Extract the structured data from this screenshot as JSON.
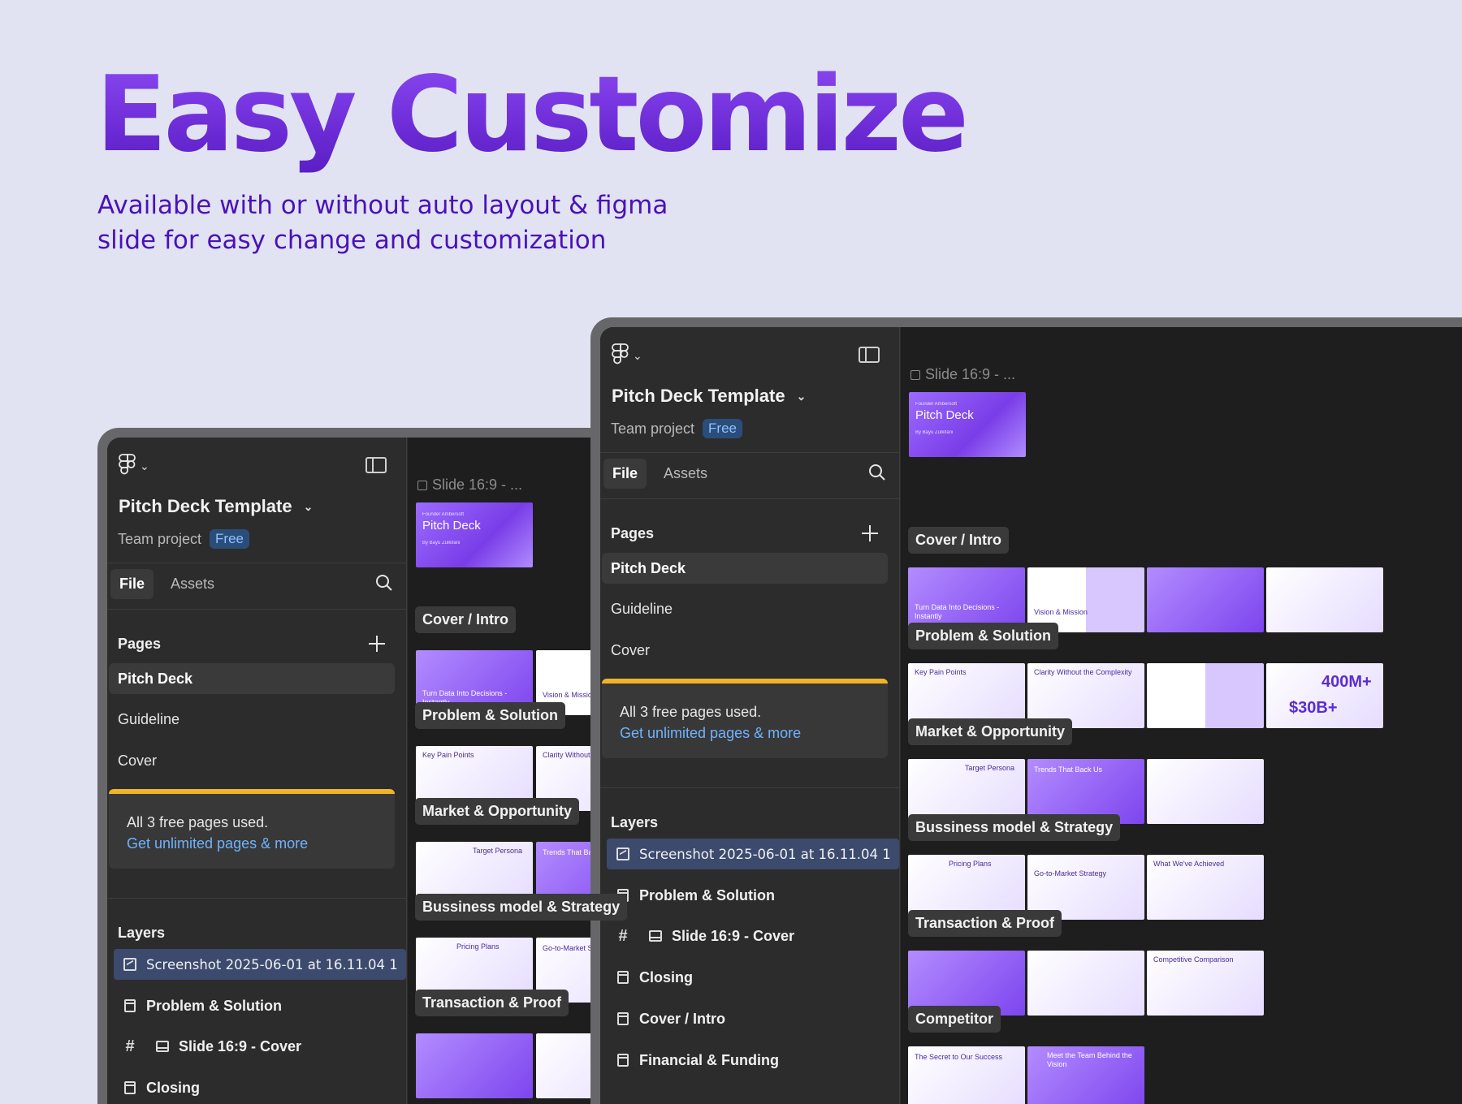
{
  "hero": {
    "title": "Easy Customize",
    "subtitle": "Available with or without auto layout & figma slide for easy change and customization"
  },
  "colors": {
    "accent": "#7b36ea",
    "subtitle": "#4a12b8",
    "badge_bg": "#2b4d7a",
    "notice_bar": "#f0b429",
    "link": "#6fb3ff"
  },
  "app": {
    "project_title": "Pitch Deck Template",
    "team": "Team project",
    "plan_badge": "Free",
    "tabs": [
      "File",
      "Assets"
    ],
    "pages_title": "Pages",
    "pages": [
      "Pitch Deck",
      "Guideline",
      "Cover"
    ],
    "notice_line1": "All 3 free pages used.",
    "notice_link": "Get unlimited pages & more",
    "layers_title": "Layers",
    "layers": [
      {
        "label": "Screenshot 2025-06-01 at 16.11.04 1",
        "icon": "image-icon"
      },
      {
        "label": "Problem & Solution",
        "icon": "frame-icon"
      },
      {
        "label": "Slide 16:9 - Cover",
        "icon": "slide-icon"
      },
      {
        "label": "Closing",
        "icon": "frame-icon"
      },
      {
        "label": "Cover / Intro",
        "icon": "frame-icon"
      },
      {
        "label": "Financial & Funding",
        "icon": "frame-icon"
      }
    ],
    "canvas": {
      "slide_label": "Slide 16:9 - ...",
      "cover_small": "Pitch Deck",
      "cover_kicker": "Founder Ambersoft",
      "cover_by": "By Bayu Zulkifani",
      "sections": [
        "Cover / Intro",
        "Problem & Solution",
        "Market & Opportunity",
        "Bussiness model & Strategy",
        "Transaction & Proof",
        "Competitor"
      ],
      "thumb_texts": {
        "turn_data": "Turn Data Into Decisions - Instantly",
        "vision": "Vision & Mission",
        "key_pain": "Key Pain Points",
        "clarity": "Clarity Without the Complexity",
        "trends": "Trends That Back Us",
        "target": "Target Persona",
        "pricing": "Pricing Plans",
        "gtm": "Go-to-Market Strategy",
        "achieved": "What We've Achieved",
        "market_big1": "400M+",
        "market_big2": "$30B+",
        "secret": "The Secret to Our Success",
        "team": "Meet the Team Behind the Vision",
        "competitive": "Competitive Comparison"
      }
    }
  }
}
